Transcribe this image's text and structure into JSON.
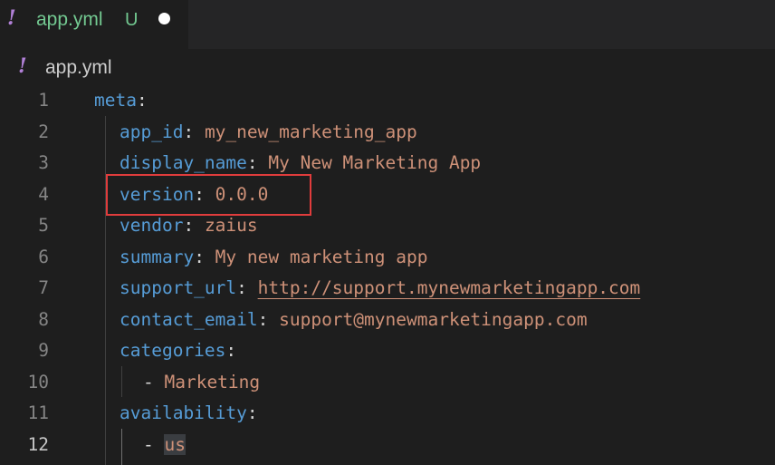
{
  "tab": {
    "icon_glyph": "!",
    "filename": "app.yml",
    "status": "U",
    "unsaved_dot_icon": "unsaved-dot-icon"
  },
  "breadcrumb": {
    "icon_glyph": "!",
    "filename": "app.yml"
  },
  "colors": {
    "key": "#569cd6",
    "value": "#ce9178",
    "number": "#b5cea8",
    "yaml_icon": "#b180d7",
    "git_untracked": "#73c991",
    "highlight_box": "#e03c3c"
  },
  "editor": {
    "active_line": "12",
    "lines": [
      {
        "num": "1",
        "key": "meta",
        "sep": ":",
        "value": ""
      },
      {
        "num": "2",
        "key": "app_id",
        "sep": ": ",
        "value": "my_new_marketing_app"
      },
      {
        "num": "3",
        "key": "display_name",
        "sep": ": ",
        "value": "My New Marketing App"
      },
      {
        "num": "4",
        "key": "version",
        "sep": ": ",
        "value": "0.0.0"
      },
      {
        "num": "5",
        "key": "vendor",
        "sep": ": ",
        "value": "zaius"
      },
      {
        "num": "6",
        "key": "summary",
        "sep": ": ",
        "value": "My new marketing app"
      },
      {
        "num": "7",
        "key": "support_url",
        "sep": ": ",
        "value": "http://support.mynewmarketingapp.com"
      },
      {
        "num": "8",
        "key": "contact_email",
        "sep": ": ",
        "value": "support@mynewmarketingapp.com"
      },
      {
        "num": "9",
        "key": "categories",
        "sep": ":",
        "value": ""
      },
      {
        "num": "10",
        "dash": "- ",
        "value": "Marketing"
      },
      {
        "num": "11",
        "key": "availability",
        "sep": ":",
        "value": ""
      },
      {
        "num": "12",
        "dash": "- ",
        "value": "us"
      }
    ]
  }
}
